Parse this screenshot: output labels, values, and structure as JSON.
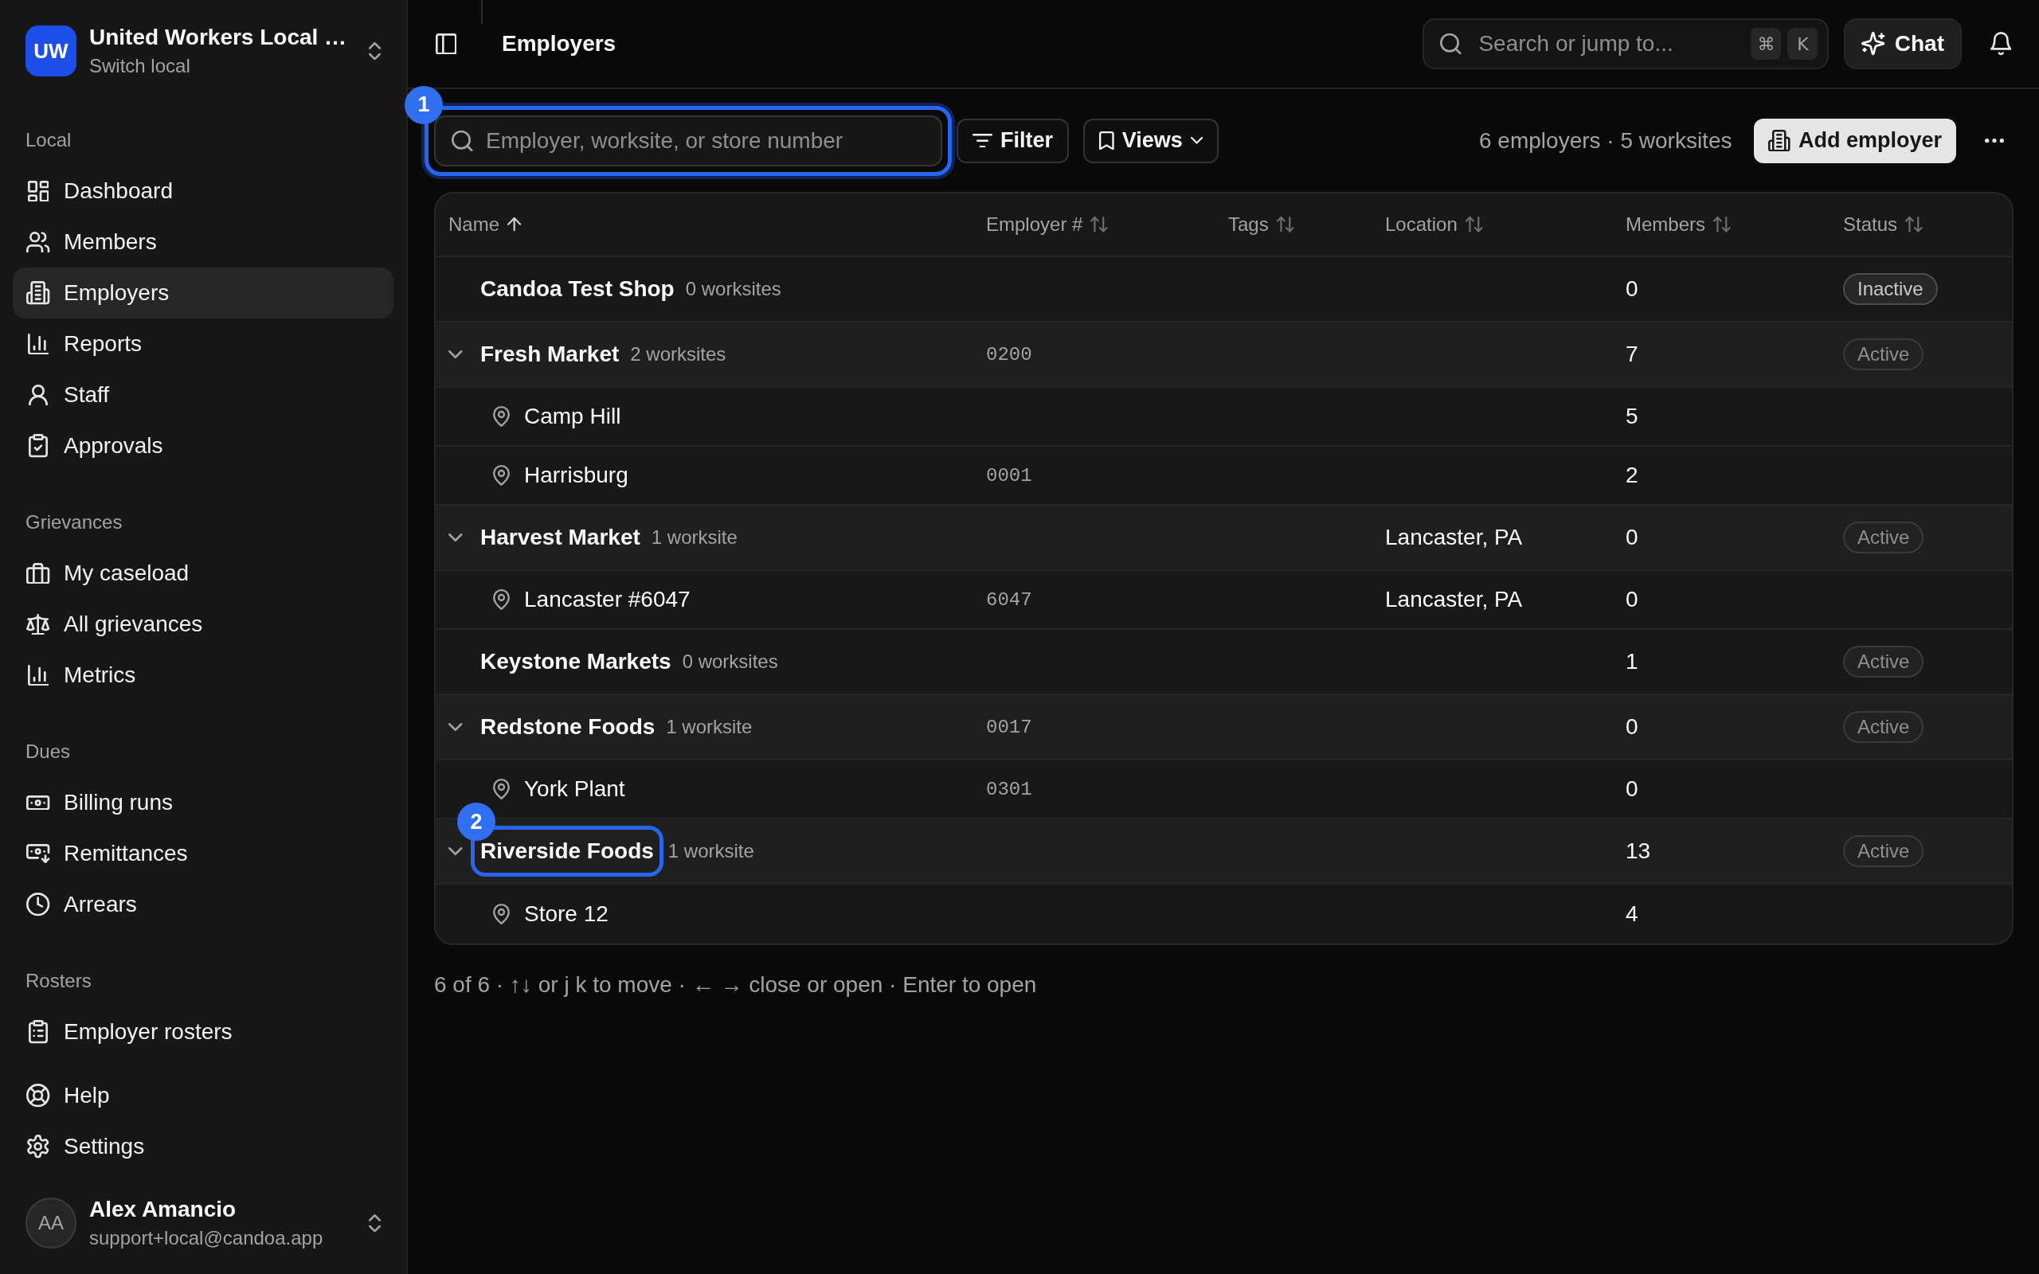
{
  "sidebar": {
    "org": {
      "initials": "UW",
      "name": "United Workers Local …",
      "subtitle": "Switch local"
    },
    "groups": [
      {
        "label": "Local",
        "items": [
          {
            "label": "Dashboard",
            "selected": false
          },
          {
            "label": "Members",
            "selected": false
          },
          {
            "label": "Employers",
            "selected": true
          },
          {
            "label": "Reports",
            "selected": false
          },
          {
            "label": "Staff",
            "selected": false
          },
          {
            "label": "Approvals",
            "selected": false
          }
        ]
      },
      {
        "label": "Grievances",
        "items": [
          {
            "label": "My caseload",
            "selected": false
          },
          {
            "label": "All grievances",
            "selected": false
          },
          {
            "label": "Metrics",
            "selected": false
          }
        ]
      },
      {
        "label": "Dues",
        "items": [
          {
            "label": "Billing runs",
            "selected": false
          },
          {
            "label": "Remittances",
            "selected": false
          },
          {
            "label": "Arrears",
            "selected": false
          }
        ]
      },
      {
        "label": "Rosters",
        "items": [
          {
            "label": "Employer rosters",
            "selected": false
          }
        ]
      },
      {
        "items": [
          {
            "label": "Help",
            "selected": false
          },
          {
            "label": "Settings",
            "selected": false
          }
        ]
      }
    ],
    "user": {
      "initials": "AA",
      "name": "Alex Amancio",
      "email": "support+local@candoa.app"
    }
  },
  "topbar": {
    "title": "Employers",
    "search": {
      "placeholder": "Search or jump to...",
      "keys": [
        "⌘",
        "K"
      ]
    },
    "chat_button": "Chat"
  },
  "toolbar": {
    "search": {
      "placeholder": "Employer, worksite, or store number",
      "marker": "1"
    },
    "filter_button": "Filter",
    "views_button": "Views",
    "summary": "6 employers · 5 worksites",
    "add_button": "Add employer"
  },
  "table": {
    "columns": [
      {
        "label": "Name",
        "sorted": true
      },
      {
        "label": "Employer #",
        "sorted": false
      },
      {
        "label": "Tags",
        "sorted": false
      },
      {
        "label": "Location",
        "sorted": false
      },
      {
        "label": "Members",
        "sorted": false
      },
      {
        "label": "Status",
        "sorted": false
      }
    ],
    "employers": [
      {
        "name": "Candoa Test Shop",
        "worksites": "0 worksites",
        "members": "0",
        "status": "Inactive",
        "active": false
      },
      {
        "name": "Fresh Market",
        "worksites": "2 worksites",
        "employer_number": "0200",
        "members": "7",
        "status": "Active",
        "active": true,
        "expanded": true,
        "children": [
          {
            "name": "Camp Hill",
            "members": "5"
          },
          {
            "name": "Harrisburg",
            "employer_number": "0001",
            "members": "2"
          }
        ]
      },
      {
        "name": "Harvest Market",
        "worksites": "1 worksite",
        "location": "Lancaster, PA",
        "members": "0",
        "status": "Active",
        "active": true,
        "expanded": true,
        "children": [
          {
            "name": "Lancaster #6047",
            "employer_number": "6047",
            "location": "Lancaster, PA",
            "members": "0"
          }
        ]
      },
      {
        "name": "Keystone Markets",
        "worksites": "0 worksites",
        "members": "1",
        "status": "Active",
        "active": true
      },
      {
        "name": "Redstone Foods",
        "worksites": "1 worksite",
        "employer_number": "0017",
        "members": "0",
        "status": "Active",
        "active": true,
        "expanded": true,
        "children": [
          {
            "name": "York Plant",
            "employer_number": "0301",
            "members": "0"
          }
        ]
      },
      {
        "name": "Riverside Foods",
        "worksites": "1 worksite",
        "members": "13",
        "status": "Active",
        "active": true,
        "expanded": true,
        "marker": "2",
        "children": [
          {
            "name": "Store 12",
            "members": "4"
          }
        ]
      }
    ]
  },
  "hint": "6 of 6 · ↑↓ or j k to move · ← → close or open · Enter to open"
}
